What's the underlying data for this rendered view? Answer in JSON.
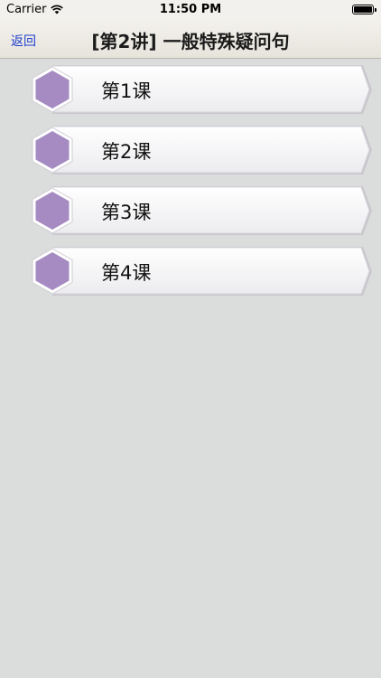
{
  "status_bar": {
    "carrier": "Carrier",
    "time": "11:50 PM",
    "wifi_icon": "wifi-icon",
    "battery_icon": "battery-icon"
  },
  "nav": {
    "back_label": "返回",
    "title": "[第2讲] 一般特殊疑问句"
  },
  "lessons": [
    {
      "label": "第1课",
      "icon": "hexagon-icon"
    },
    {
      "label": "第2课",
      "icon": "hexagon-icon"
    },
    {
      "label": "第3课",
      "icon": "hexagon-icon"
    },
    {
      "label": "第4课",
      "icon": "hexagon-icon"
    }
  ],
  "colors": {
    "background": "#dbdddc",
    "hexagon_purple": "#a58bc2",
    "back_link_blue": "#1e3fcf"
  }
}
